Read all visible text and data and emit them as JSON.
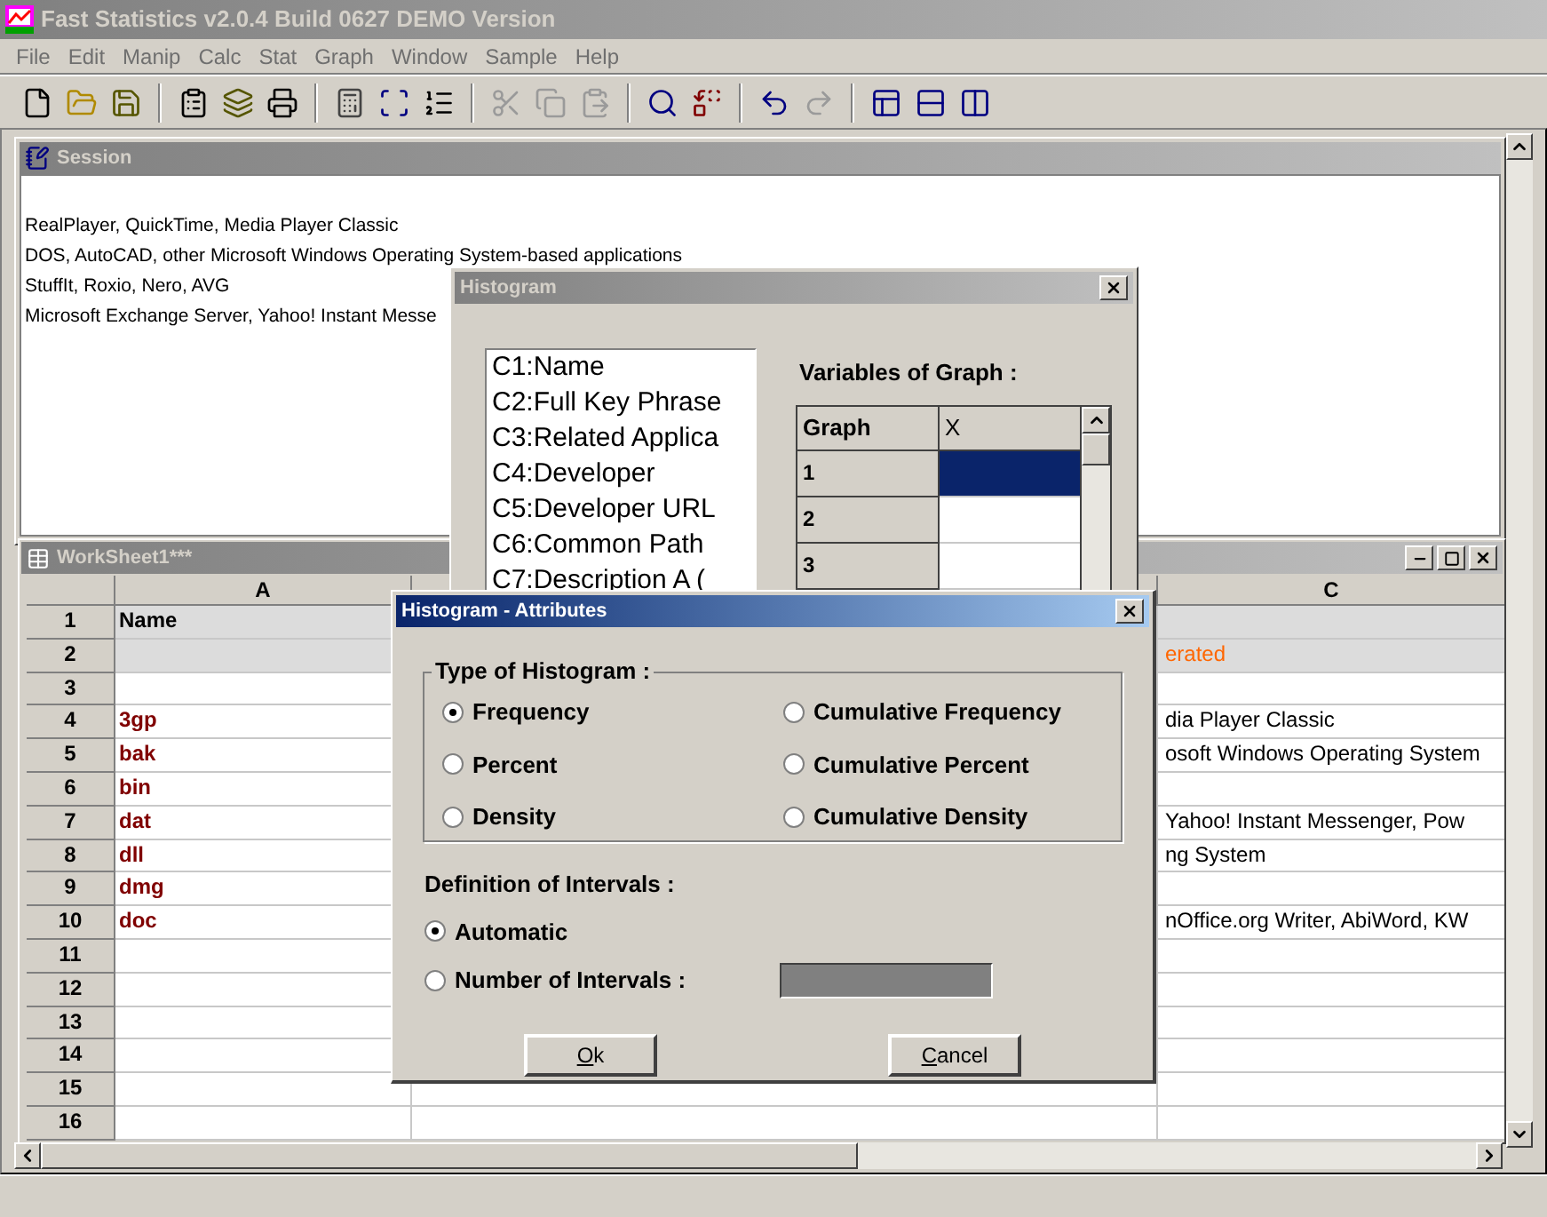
{
  "window": {
    "title": "Fast Statistics v2.0.4 Build 0627 DEMO Version"
  },
  "menu": [
    "File",
    "Edit",
    "Manip",
    "Calc",
    "Stat",
    "Graph",
    "Window",
    "Sample",
    "Help"
  ],
  "toolbar": [
    {
      "kind": "new",
      "disabled": false
    },
    {
      "kind": "open",
      "disabled": false
    },
    {
      "kind": "save",
      "disabled": false
    },
    {
      "kind": "separator"
    },
    {
      "kind": "properties",
      "disabled": false
    },
    {
      "kind": "save_all",
      "disabled": false
    },
    {
      "kind": "print",
      "disabled": false
    },
    {
      "kind": "separator"
    },
    {
      "kind": "calculator",
      "disabled": false
    },
    {
      "kind": "select",
      "disabled": false
    },
    {
      "kind": "list",
      "disabled": false
    },
    {
      "kind": "separator"
    },
    {
      "kind": "cut",
      "disabled": true
    },
    {
      "kind": "copy",
      "disabled": true
    },
    {
      "kind": "paste",
      "disabled": true
    },
    {
      "kind": "separator"
    },
    {
      "kind": "find",
      "disabled": false
    },
    {
      "kind": "replace",
      "disabled": false
    },
    {
      "kind": "separator"
    },
    {
      "kind": "undo",
      "disabled": false
    },
    {
      "kind": "redo",
      "disabled": true
    },
    {
      "kind": "separator"
    },
    {
      "kind": "cascade",
      "disabled": false
    },
    {
      "kind": "tile_horizontal",
      "disabled": false
    },
    {
      "kind": "tile_vertical",
      "disabled": false
    }
  ],
  "session": {
    "title": "Session",
    "lines": [
      "RealPlayer, QuickTime, Media Player Classic",
      "DOS, AutoCAD, other Microsoft Windows Operating System-based applications",
      "StuffIt, Roxio, Nero, AVG",
      "Microsoft Exchange Server, Yahoo! Instant Messe"
    ]
  },
  "worksheet": {
    "title": "WorkSheet1***",
    "columns": [
      "A",
      "C"
    ],
    "rows": [
      {
        "number": "1",
        "shaded": true,
        "a": {
          "text": "Name",
          "color": "#000000"
        }
      },
      {
        "number": "2",
        "shaded": true,
        "c": {
          "text": "erated",
          "color": "#ff6600"
        }
      },
      {
        "number": "3",
        "shaded": false
      },
      {
        "number": "4",
        "shaded": false,
        "a": {
          "text": "3gp",
          "color": "#800000"
        },
        "c": {
          "text": "dia Player Classic",
          "color": "#000000"
        }
      },
      {
        "number": "5",
        "shaded": false,
        "a": {
          "text": "bak",
          "color": "#800000"
        },
        "c": {
          "text": "osoft Windows Operating System",
          "color": "#000000"
        }
      },
      {
        "number": "6",
        "shaded": false,
        "a": {
          "text": "bin",
          "color": "#800000"
        }
      },
      {
        "number": "7",
        "shaded": false,
        "a": {
          "text": "dat",
          "color": "#800000"
        },
        "c": {
          "text": "Yahoo! Instant Messenger, Pow",
          "color": "#000000"
        }
      },
      {
        "number": "8",
        "shaded": false,
        "a": {
          "text": "dll",
          "color": "#800000"
        },
        "c": {
          "text": "ng System",
          "color": "#000000"
        }
      },
      {
        "number": "9",
        "shaded": false,
        "a": {
          "text": "dmg",
          "color": "#800000"
        }
      },
      {
        "number": "10",
        "shaded": false,
        "a": {
          "text": "doc",
          "color": "#800000"
        },
        "c": {
          "text": "nOffice.org Writer, AbiWord, KW",
          "color": "#000000"
        }
      },
      {
        "number": "11",
        "shaded": false
      },
      {
        "number": "12",
        "shaded": false
      },
      {
        "number": "13",
        "shaded": false
      },
      {
        "number": "14",
        "shaded": false
      },
      {
        "number": "15",
        "shaded": false
      },
      {
        "number": "16",
        "shaded": false
      }
    ]
  },
  "histogram": {
    "title": "Histogram",
    "variables": [
      "C1:Name",
      "C2:Full Key Phrase",
      "C3:Related Applica",
      "C4:Developer",
      "C5:Developer URL",
      "C6:Common Path",
      "C7:Description A ("
    ],
    "graph_label": "Variables of Graph :",
    "graph_columns": [
      "Graph",
      "X"
    ],
    "graph_rows": [
      {
        "number": "1",
        "selected": true
      },
      {
        "number": "2",
        "selected": false
      },
      {
        "number": "3",
        "selected": false
      }
    ]
  },
  "attributes": {
    "title": "Histogram - Attributes",
    "type_group": "Type of Histogram :",
    "types": [
      {
        "label": "Frequency",
        "selected": true
      },
      {
        "label": "Cumulative Frequency",
        "selected": false
      },
      {
        "label": "Percent",
        "selected": false
      },
      {
        "label": "Cumulative Percent",
        "selected": false
      },
      {
        "label": "Density",
        "selected": false
      },
      {
        "label": "Cumulative Density",
        "selected": false
      }
    ],
    "intervals_label": "Definition of Intervals :",
    "intervals": [
      {
        "label": "Automatic",
        "selected": true
      },
      {
        "label": "Number of Intervals :",
        "selected": false
      }
    ],
    "intervals_field": {
      "disabled": true
    },
    "buttons": [
      "Ok",
      "Cancel"
    ]
  }
}
